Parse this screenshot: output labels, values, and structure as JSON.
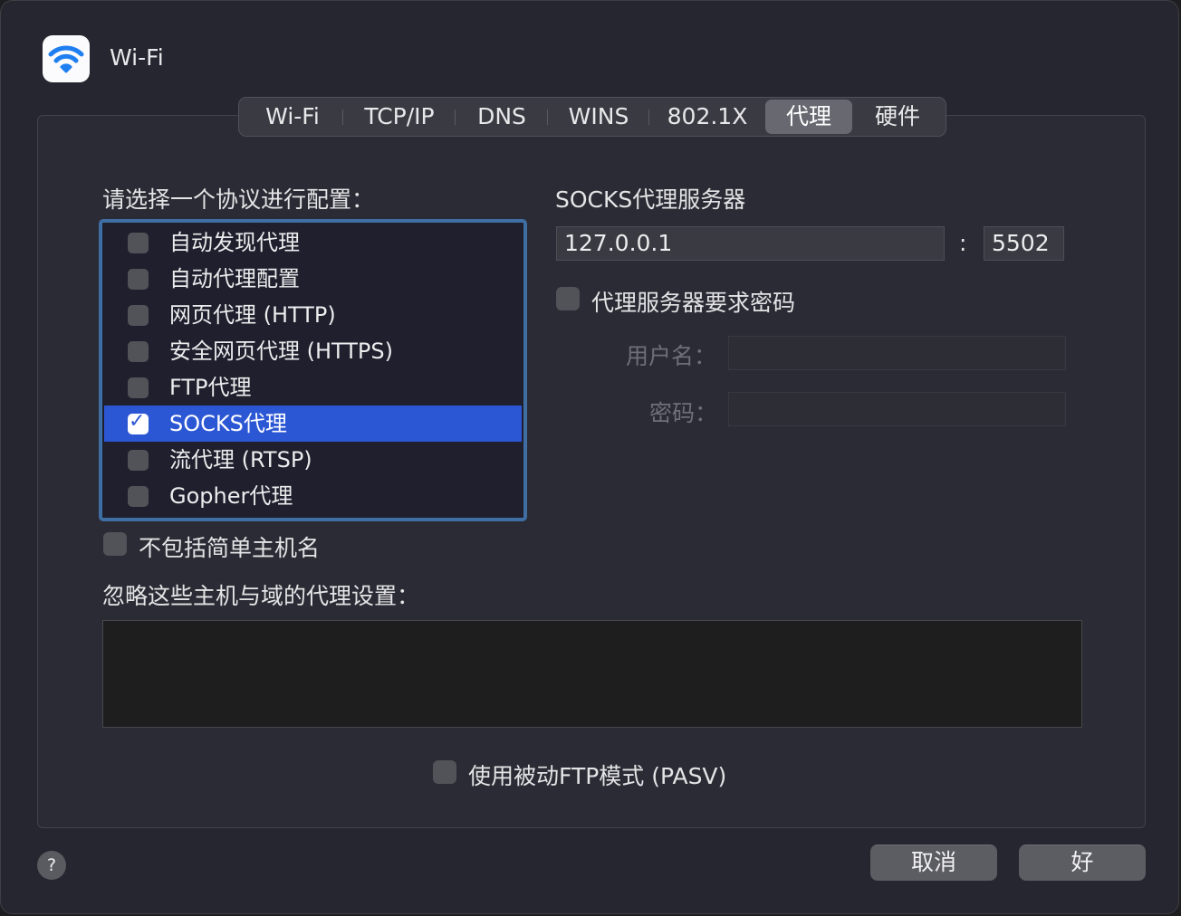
{
  "window": {
    "title": "Wi-Fi",
    "icon": "wifi-icon"
  },
  "tabs": [
    {
      "label": "Wi-Fi",
      "active": false
    },
    {
      "label": "TCP/IP",
      "active": false
    },
    {
      "label": "DNS",
      "active": false
    },
    {
      "label": "WINS",
      "active": false
    },
    {
      "label": "802.1X",
      "active": false
    },
    {
      "label": "代理",
      "active": true
    },
    {
      "label": "硬件",
      "active": false
    }
  ],
  "protocols": {
    "heading": "请选择一个协议进行配置：",
    "items": [
      {
        "label": "自动发现代理",
        "checked": false,
        "selected": false
      },
      {
        "label": "自动代理配置",
        "checked": false,
        "selected": false
      },
      {
        "label": "网页代理 (HTTP)",
        "checked": false,
        "selected": false
      },
      {
        "label": "安全网页代理 (HTTPS)",
        "checked": false,
        "selected": false
      },
      {
        "label": "FTP代理",
        "checked": false,
        "selected": false
      },
      {
        "label": "SOCKS代理",
        "checked": true,
        "selected": true
      },
      {
        "label": "流代理 (RTSP)",
        "checked": false,
        "selected": false
      },
      {
        "label": "Gopher代理",
        "checked": false,
        "selected": false
      }
    ]
  },
  "socks": {
    "heading": "SOCKS代理服务器",
    "server": "127.0.0.1",
    "colon": ":",
    "port": "5502",
    "password_required_label": "代理服务器要求密码",
    "password_required": false,
    "username_label": "用户名：",
    "username": "",
    "password_label": "密码：",
    "password": ""
  },
  "exclude_simple_label": "不包括简单主机名",
  "exclude_simple": false,
  "bypass_heading": "忽略这些主机与域的代理设置：",
  "bypass_value": "",
  "pasv_label": "使用被动FTP模式 (PASV)",
  "pasv": false,
  "buttons": {
    "help": "?",
    "cancel": "取消",
    "ok": "好"
  },
  "colors": {
    "selection": "#2c57d4",
    "focus_ring": "#3f6ea3",
    "wifi_blue": "#1f7ff0"
  }
}
